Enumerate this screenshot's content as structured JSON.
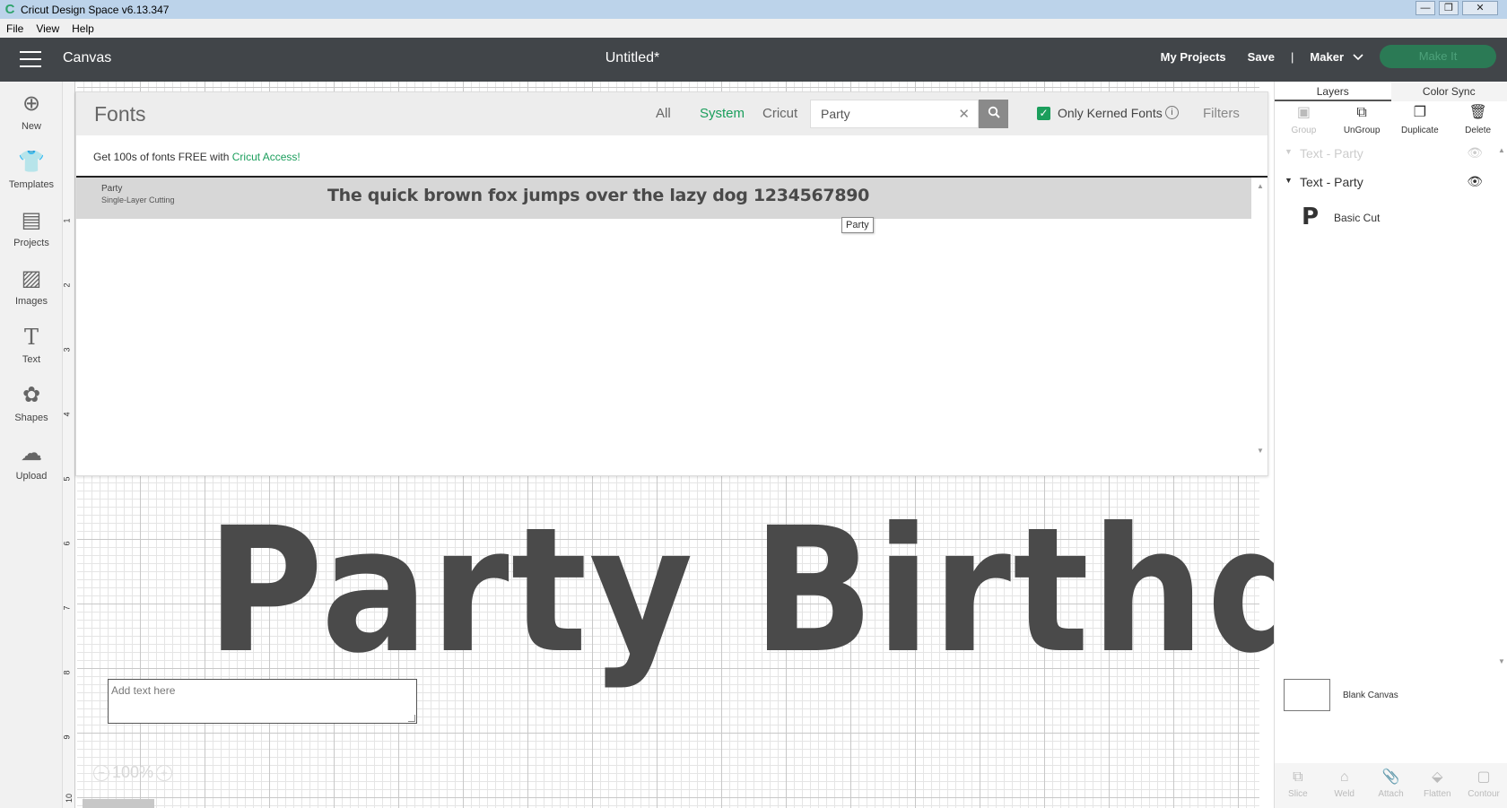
{
  "window": {
    "title": "Cricut Design Space  v6.13.347",
    "controls": {
      "minimize": "—",
      "restore": "❐",
      "close": "✕"
    }
  },
  "menu": [
    "File",
    "View",
    "Help"
  ],
  "header": {
    "section": "Canvas",
    "doc_title": "Untitled*",
    "my_projects": "My Projects",
    "save": "Save",
    "separator": "|",
    "machine": "Maker",
    "make_it": "Make It"
  },
  "left_tools": [
    {
      "label": "New",
      "icon": "plus-circle-icon",
      "glyph": "⊕"
    },
    {
      "label": "Templates",
      "icon": "tshirt-icon",
      "glyph": "👕"
    },
    {
      "label": "Projects",
      "icon": "projects-icon",
      "glyph": "▤"
    },
    {
      "label": "Images",
      "icon": "image-icon",
      "glyph": "▨"
    },
    {
      "label": "Text",
      "icon": "text-icon",
      "glyph": "T"
    },
    {
      "label": "Shapes",
      "icon": "shapes-icon",
      "glyph": "✿"
    },
    {
      "label": "Upload",
      "icon": "upload-cloud-icon",
      "glyph": "☁"
    }
  ],
  "fonts_panel": {
    "title": "Fonts",
    "filters": [
      "All",
      "System",
      "Cricut"
    ],
    "active_filter": "System",
    "search_value": "Party",
    "only_kerned_label": "Only Kerned Fonts",
    "only_kerned_checked": true,
    "filters_label": "Filters",
    "promo_text": "Get 100s of fonts FREE with ",
    "promo_link": "Cricut Access!",
    "results": [
      {
        "name": "Party",
        "type": "Single-Layer Cutting",
        "sample": "The quick brown fox jumps over the lazy dog 1234567890"
      }
    ],
    "tooltip": "Party"
  },
  "canvas": {
    "design_text": "Party Birthday",
    "ruler_ticks": [
      "1",
      "2",
      "3",
      "4",
      "5",
      "6",
      "7",
      "8",
      "9",
      "10"
    ],
    "add_text_placeholder": "Add text here",
    "zoom": "100%"
  },
  "right_panel": {
    "tabs": [
      "Layers",
      "Color Sync"
    ],
    "active_tab": "Layers",
    "tools": [
      {
        "label": "Group",
        "enabled": false
      },
      {
        "label": "UnGroup",
        "enabled": true
      },
      {
        "label": "Duplicate",
        "enabled": true
      },
      {
        "label": "Delete",
        "enabled": true
      }
    ],
    "layers": [
      {
        "label": "Text - Party",
        "ghost": true
      },
      {
        "label": "Text - Party",
        "ghost": false
      }
    ],
    "sublayer": {
      "glyph": "P",
      "label": "Basic Cut"
    },
    "blank_canvas": "Blank Canvas",
    "bottom_tools": [
      "Slice",
      "Weld",
      "Attach",
      "Flatten",
      "Contour"
    ]
  }
}
